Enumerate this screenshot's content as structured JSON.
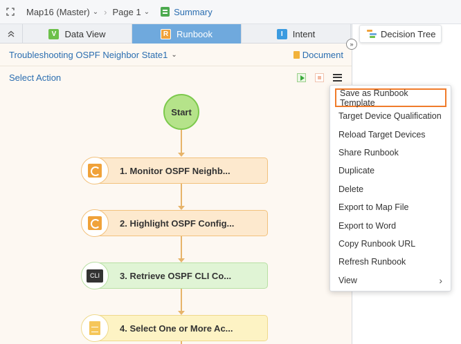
{
  "topbar": {
    "map_label": "Map16 (Master)",
    "page_label": "Page 1",
    "summary_label": "Summary"
  },
  "tabs": [
    {
      "label": "Data View",
      "badge": "V"
    },
    {
      "label": "Runbook",
      "badge": "R",
      "active": true
    },
    {
      "label": "Intent",
      "badge": "I"
    }
  ],
  "right_pane": {
    "decision_tree_label": "Decision Tree"
  },
  "runbook": {
    "title": "Troubleshooting OSPF Neighbor State1",
    "document_label": "Document",
    "select_action_label": "Select Action"
  },
  "flow": {
    "start_label": "Start",
    "nodes": [
      {
        "label": "1. Monitor OSPF Neighb...",
        "kind": "monitor"
      },
      {
        "label": "2. Highlight OSPF Config...",
        "kind": "monitor"
      },
      {
        "label": "3. Retrieve OSPF CLI Co...",
        "kind": "cli",
        "icon_text": "CLI"
      },
      {
        "label": "4. Select One or More Ac...",
        "kind": "document"
      }
    ]
  },
  "menu": {
    "items": [
      {
        "label": "Save as Runbook Template",
        "highlighted": true
      },
      {
        "label": "Target Device Qualification"
      },
      {
        "label": "Reload Target Devices"
      },
      {
        "label": "Share Runbook"
      },
      {
        "label": "Duplicate"
      },
      {
        "label": "Delete"
      },
      {
        "label": "Export to Map File"
      },
      {
        "label": "Export to Word"
      },
      {
        "label": "Copy Runbook URL"
      },
      {
        "label": "Refresh Runbook"
      },
      {
        "label": "View",
        "submenu": true
      }
    ]
  },
  "colors": {
    "accent_blue": "#2a6db0",
    "active_tab": "#6fa9dd",
    "highlight_border": "#f07b2a",
    "flow_line": "#e7b46a"
  }
}
